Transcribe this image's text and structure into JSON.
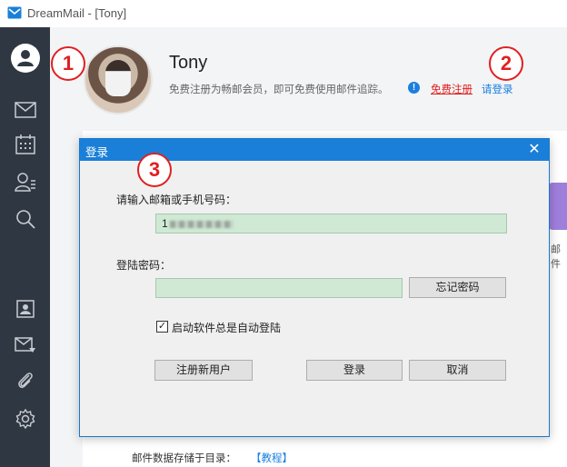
{
  "window": {
    "title": "DreamMail - [Tony]"
  },
  "sidebar": {
    "items": [
      {
        "icon": "user-icon"
      },
      {
        "icon": "mail-icon"
      },
      {
        "icon": "calendar-icon"
      },
      {
        "icon": "contacts-icon"
      },
      {
        "icon": "search-icon"
      },
      {
        "icon": "address-book-icon"
      },
      {
        "icon": "mail-filter-icon"
      },
      {
        "icon": "attachment-icon"
      },
      {
        "icon": "settings-icon"
      }
    ]
  },
  "profile": {
    "name": "Tony",
    "promo_text": "免费注册为畅邮会员，即可免费使用邮件追踪。",
    "info_badge": "!",
    "register_link": "免费注册",
    "login_link": "请登录"
  },
  "panel": {
    "storage_label": "邮件数据存储于目录：",
    "tutorial_link": "【教程】",
    "side_label": "邮件"
  },
  "badges": [
    "1",
    "2",
    "3"
  ],
  "dialog": {
    "title": "登录",
    "close_glyph": "✕",
    "account_label": "请输入邮箱或手机号码：",
    "account_value_prefix": "1",
    "password_label": "登陆密码：",
    "password_value": "",
    "forgot_button": "忘记密码",
    "auto_login_label": "启动软件总是自动登陆",
    "auto_login_checked": "✓",
    "register_button": "注册新用户",
    "login_button": "登录",
    "cancel_button": "取消"
  },
  "colors": {
    "sidebar_bg": "#2f3742",
    "titlebar_accent": "#1a7fd8",
    "field_bg": "#cfe9d4",
    "badge_red": "#e02020",
    "link_blue": "#1a7fe0"
  }
}
